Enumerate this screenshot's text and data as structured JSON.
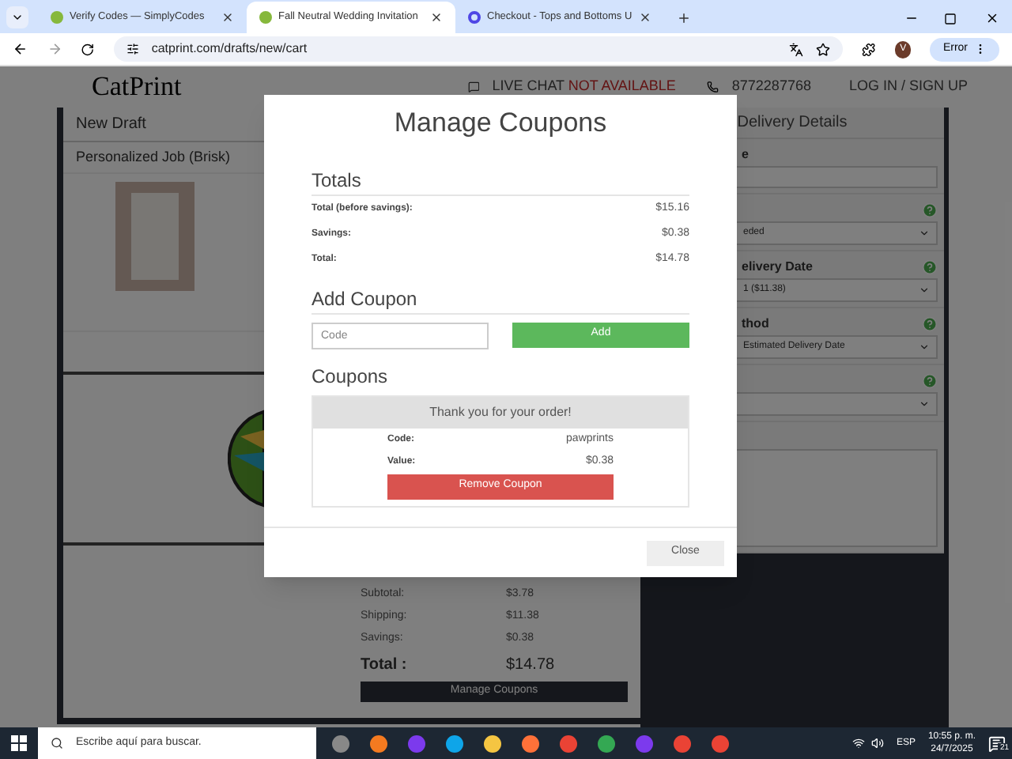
{
  "browser": {
    "tabs": [
      {
        "title": "Verify Codes — SimplyCodes",
        "selected": false
      },
      {
        "title": "Fall Neutral Wedding Invitation",
        "selected": true
      },
      {
        "title": "Checkout - Tops and Bottoms U",
        "selected": false
      }
    ],
    "address": "catprint.com/drafts/new/cart",
    "profile_initial": "V",
    "error_label": "Error"
  },
  "header": {
    "logo": "CatPrint",
    "live_chat": "LIVE CHAT",
    "chat_status": "NOT AVAILABLE",
    "phone": "8772287768",
    "login": "LOG IN / SIGN UP"
  },
  "left_panel": {
    "title": "New Draft",
    "job": "Personalized Job (Brisk)",
    "summary": [
      {
        "label": "Subtotal:",
        "value": "$3.78"
      },
      {
        "label": "Shipping:",
        "value": "$11.38"
      },
      {
        "label": "Savings:",
        "value": "$0.38"
      }
    ],
    "total": {
      "label": "Total :",
      "value": "$14.78"
    },
    "manage_button": "Manage Coupons"
  },
  "right_panel": {
    "title": "Delivery Details",
    "fields": [
      {
        "kind": "input",
        "label": "e",
        "help": false
      },
      {
        "kind": "select",
        "value": "eded",
        "help": true
      },
      {
        "kind": "select",
        "label": "elivery Date",
        "value": "1 ($11.38)",
        "help": true
      },
      {
        "kind": "select",
        "label": "thod",
        "value": "Estimated Delivery Date",
        "help": true
      },
      {
        "kind": "select",
        "help": true
      },
      {
        "kind": "textarea",
        "help": false
      }
    ]
  },
  "modal": {
    "title": "Manage Coupons",
    "totals_heading": "Totals",
    "totals": [
      {
        "label": "Total (before savings):",
        "value": "$15.16"
      },
      {
        "label": "Savings:",
        "value": "$0.38"
      },
      {
        "label": "Total:",
        "value": "$14.78"
      }
    ],
    "add_heading": "Add Coupon",
    "code_placeholder": "Code",
    "add_button": "Add",
    "coupons_heading": "Coupons",
    "coupon": {
      "message": "Thank you for your order!",
      "code_label": "Code:",
      "code": "pawprints",
      "value_label": "Value:",
      "value": "$0.38",
      "remove_button": "Remove Coupon"
    },
    "close_button": "Close"
  },
  "taskbar": {
    "search_placeholder": "Escribe aquí para buscar.",
    "language": "ESP",
    "time": "10:55 p. m.",
    "date": "24/7/2025",
    "notifications": "21"
  }
}
